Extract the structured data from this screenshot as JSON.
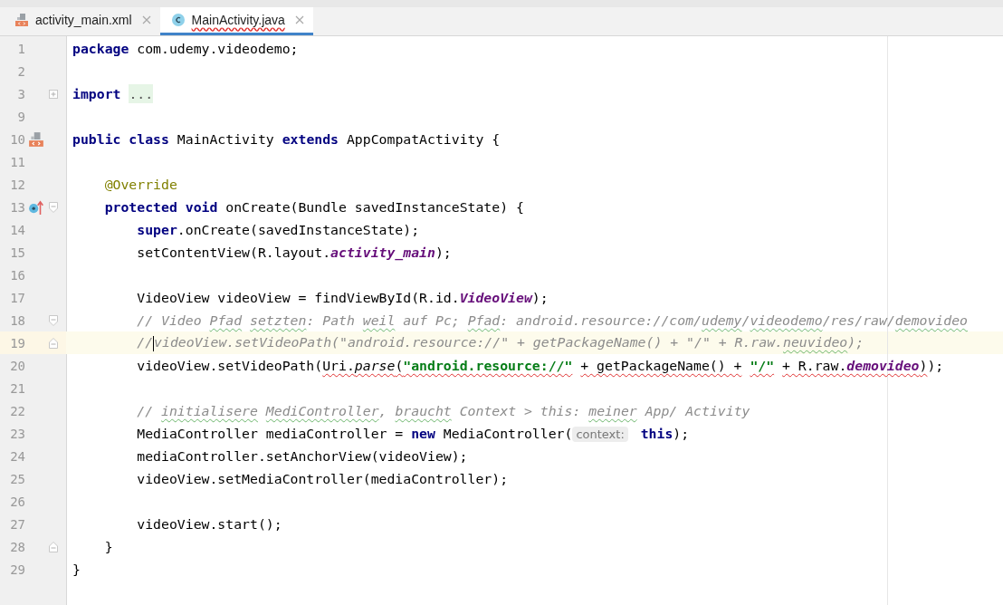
{
  "tabs": [
    {
      "label": "activity_main.xml",
      "kind": "layout",
      "selected": false,
      "error": false
    },
    {
      "label": "MainActivity.java",
      "kind": "class",
      "selected": true,
      "error": true
    }
  ],
  "lines": [
    {
      "number": "1",
      "tokens": [
        {
          "kind": "keyword",
          "text": "package "
        },
        {
          "kind": "plain",
          "text": "com.udemy.videodemo;"
        }
      ]
    },
    {
      "number": "2"
    },
    {
      "number": "3",
      "folded": true,
      "tokens": [
        {
          "kind": "keyword",
          "text": "import "
        },
        {
          "kind": "folded",
          "text": "..."
        }
      ]
    },
    {
      "number": "9"
    },
    {
      "number": "10",
      "layout_link": true,
      "tokens": [
        {
          "kind": "keyword",
          "text": "public class "
        },
        {
          "kind": "plain",
          "text": "MainActivity "
        },
        {
          "kind": "keyword",
          "text": "extends "
        },
        {
          "kind": "plain",
          "text": "AppCompatActivity {"
        }
      ]
    },
    {
      "number": "11"
    },
    {
      "number": "12",
      "tokens": [
        {
          "kind": "annotation",
          "text": "    @Override"
        }
      ]
    },
    {
      "number": "13",
      "overrides": true,
      "fold_start": true,
      "tokens": [
        {
          "kind": "keyword",
          "text": "    protected void "
        },
        {
          "kind": "plain",
          "text": "onCreate(Bundle savedInstanceState) {"
        }
      ]
    },
    {
      "number": "14",
      "tokens": [
        {
          "kind": "keyword",
          "text": "        super"
        },
        {
          "kind": "plain",
          "text": ".onCreate(savedInstanceState);"
        }
      ]
    },
    {
      "number": "15",
      "tokens": [
        {
          "kind": "plain",
          "text": "        setContentView(R.layout."
        },
        {
          "kind": "field",
          "text": "activity_main"
        },
        {
          "kind": "plain",
          "text": ");"
        }
      ]
    },
    {
      "number": "16"
    },
    {
      "number": "17",
      "tokens": [
        {
          "kind": "plain",
          "text": "        VideoView videoView = findViewById(R.id."
        },
        {
          "kind": "field",
          "text": "VideoView"
        },
        {
          "kind": "plain",
          "text": ");"
        }
      ]
    },
    {
      "number": "18",
      "fold_start": true,
      "tokens": [
        {
          "kind": "comment",
          "text": "        // Video "
        },
        {
          "kind": "comment",
          "text": "Pfad ",
          "typo": true
        },
        {
          "kind": "comment",
          "text": "setzten",
          "typo": true
        },
        {
          "kind": "comment",
          "text": ": Path "
        },
        {
          "kind": "comment",
          "text": "weil ",
          "typo": true
        },
        {
          "kind": "comment",
          "text": "auf Pc; "
        },
        {
          "kind": "comment",
          "text": "Pfad",
          "typo": true
        },
        {
          "kind": "comment",
          "text": ": android.resource://com/"
        },
        {
          "kind": "comment",
          "text": "udemy",
          "typo": true
        },
        {
          "kind": "comment",
          "text": "/"
        },
        {
          "kind": "comment",
          "text": "videodemo",
          "typo": true
        },
        {
          "kind": "comment",
          "text": "/res/raw/"
        },
        {
          "kind": "comment",
          "text": "demovideo",
          "typo": true
        }
      ]
    },
    {
      "number": "19",
      "current": true,
      "fold_end": true,
      "tokens": [
        {
          "kind": "comment",
          "text": "        //"
        },
        {
          "kind": "caret"
        },
        {
          "kind": "comment",
          "text": "videoView.setVideoPath(\"android.resource://\" + getPackageName() + \"/\" + R.raw."
        },
        {
          "kind": "comment",
          "text": "neuvideo",
          "typo": true
        },
        {
          "kind": "comment",
          "text": ");"
        }
      ]
    },
    {
      "number": "20",
      "tokens": [
        {
          "kind": "plain",
          "text": "        videoView.setVideoPath("
        },
        {
          "kind": "plain",
          "text": "Uri.",
          "error": true
        },
        {
          "kind": "static",
          "text": "parse",
          "error": true
        },
        {
          "kind": "plain",
          "text": "(",
          "error": true
        },
        {
          "kind": "string",
          "text": "\"android.resource://\"",
          "error": true
        },
        {
          "kind": "plain",
          "text": " + getPackageName() +",
          "error": true
        },
        {
          "kind": "string",
          "text": " \"/\"",
          "error": true
        },
        {
          "kind": "plain",
          "text": " + R.raw.",
          "error": true
        },
        {
          "kind": "field",
          "text": "demovideo",
          "error": true
        },
        {
          "kind": "plain",
          "text": ")",
          "error": true
        },
        {
          "kind": "plain",
          "text": ");"
        }
      ]
    },
    {
      "number": "21"
    },
    {
      "number": "22",
      "tokens": [
        {
          "kind": "comment",
          "text": "        // "
        },
        {
          "kind": "comment",
          "text": "initialisere ",
          "typo": true
        },
        {
          "kind": "comment",
          "text": "MediController",
          "typo": true
        },
        {
          "kind": "comment",
          "text": ", "
        },
        {
          "kind": "comment",
          "text": "braucht",
          "typo": true
        },
        {
          "kind": "comment",
          "text": " Context > this: "
        },
        {
          "kind": "comment",
          "text": "meiner",
          "typo": true
        },
        {
          "kind": "comment",
          "text": " App/ Activity"
        }
      ]
    },
    {
      "number": "23",
      "tokens": [
        {
          "kind": "plain",
          "text": "        MediaController mediaController = "
        },
        {
          "kind": "keyword",
          "text": "new"
        },
        {
          "kind": "plain",
          "text": " MediaController("
        },
        {
          "kind": "hint",
          "text": "context: "
        },
        {
          "kind": "keyword",
          "text": "this"
        },
        {
          "kind": "plain",
          "text": ");"
        }
      ]
    },
    {
      "number": "24",
      "tokens": [
        {
          "kind": "plain",
          "text": "        mediaController.setAnchorView(videoView);"
        }
      ]
    },
    {
      "number": "25",
      "tokens": [
        {
          "kind": "plain",
          "text": "        videoView.setMediaController(mediaController);"
        }
      ]
    },
    {
      "number": "26"
    },
    {
      "number": "27",
      "tokens": [
        {
          "kind": "plain",
          "text": "        videoView.start();"
        }
      ]
    },
    {
      "number": "28",
      "fold_end": true,
      "tokens": [
        {
          "kind": "plain",
          "text": "    }"
        }
      ]
    },
    {
      "number": "29",
      "tokens": [
        {
          "kind": "plain",
          "text": "}"
        }
      ]
    }
  ]
}
